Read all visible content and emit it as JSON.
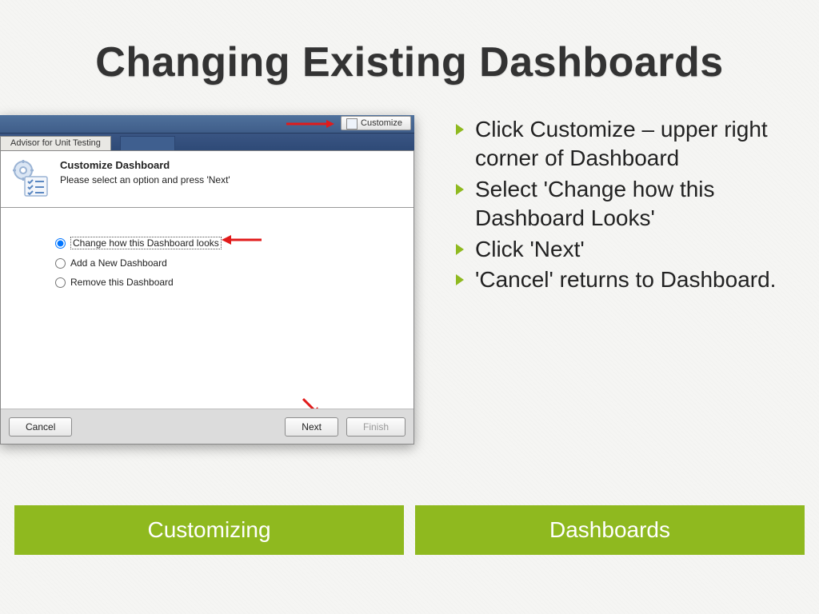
{
  "title": "Changing Existing Dashboards",
  "screenshot": {
    "customize_button": "Customize",
    "tab_active": "Advisor for Unit Testing",
    "dialog": {
      "title": "Customize Dashboard",
      "subtitle": "Please select an option and press 'Next'",
      "options": {
        "change_look": "Change how this Dashboard looks",
        "add_new": "Add a New Dashboard",
        "remove": "Remove this Dashboard"
      },
      "buttons": {
        "cancel": "Cancel",
        "next": "Next",
        "finish": "Finish"
      }
    }
  },
  "bullets": {
    "b1": "Click Customize – upper right corner of Dashboard",
    "b2": "Select 'Change how this Dashboard Looks'",
    "b3": "Click 'Next'",
    "b4": "'Cancel' returns to Dashboard."
  },
  "bars": {
    "left": "Customizing",
    "right": "Dashboards"
  },
  "colors": {
    "accent": "#8fb91f",
    "arrow": "#e11b1b"
  }
}
